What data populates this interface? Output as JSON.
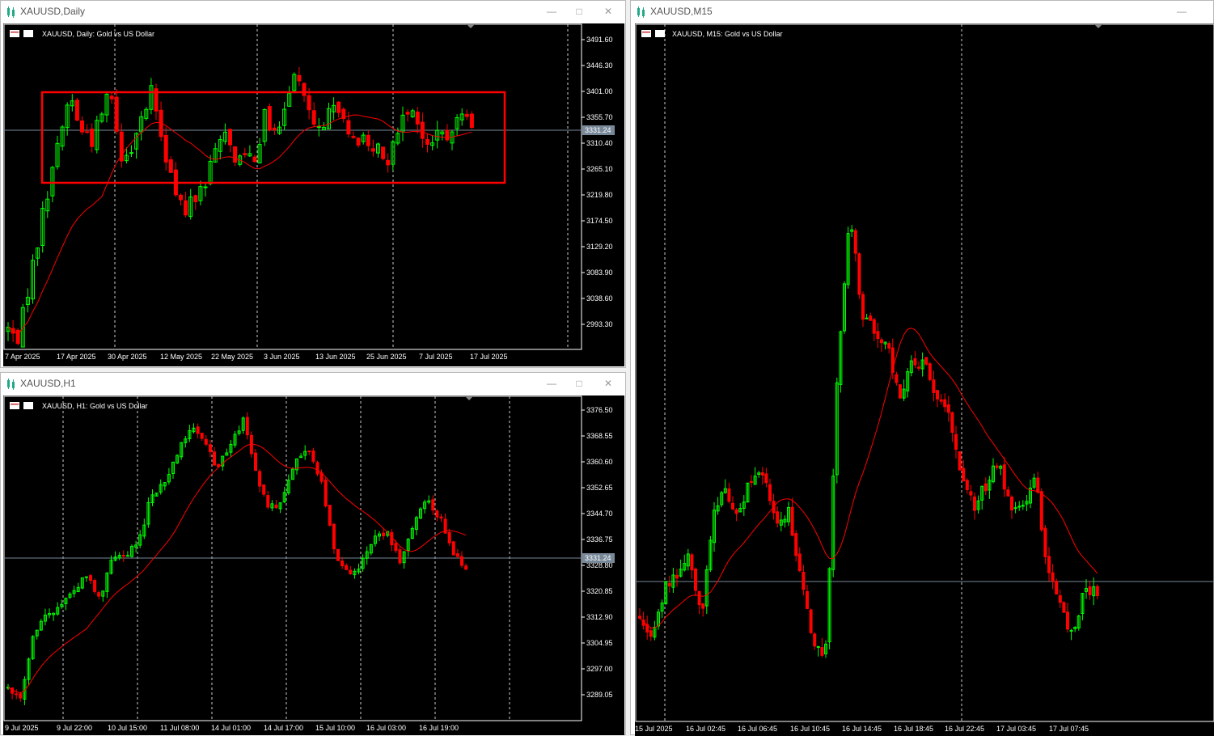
{
  "colors": {
    "bull": "#00ff00",
    "bear": "#ff0000",
    "ma": "#ff0000",
    "grid": "#ffffff",
    "priceLine": "#778899",
    "box": "#ff0000"
  },
  "windows": {
    "daily": {
      "title": "XAUUSD,Daily",
      "header": "XAUUSD, Daily:  Gold vs US Dollar",
      "price_tag": "3331.24",
      "icons": [
        "minimize-icon",
        "maximize-icon",
        "close-icon"
      ],
      "y_ticks": [
        "3491.60",
        "3446.30",
        "3401.00",
        "3355.70",
        "3310.40",
        "3265.10",
        "3219.80",
        "3174.50",
        "3129.20",
        "3083.90",
        "3038.60",
        "2993.30"
      ],
      "x_ticks": [
        "7 Apr 2025",
        "17 Apr 2025",
        "30 Apr 2025",
        "12 May 2025",
        "22 May 2025",
        "3 Jun 2025",
        "13 Jun 2025",
        "25 Jun 2025",
        "7 Jul 2025",
        "17 Jul 2025"
      ]
    },
    "h1": {
      "title": "XAUUSD,H1",
      "header": "XAUUSD, H1:  Gold vs US Dollar",
      "price_tag": "3331.24",
      "icons": [
        "minimize-icon",
        "maximize-icon",
        "close-icon"
      ],
      "y_ticks": [
        "3376.50",
        "3368.55",
        "3360.60",
        "3352.65",
        "3344.70",
        "3336.75",
        "3328.80",
        "3320.85",
        "3312.90",
        "3304.95",
        "3297.00",
        "3289.05"
      ],
      "x_ticks": [
        "9 Jul 2025",
        "9 Jul 22:00",
        "10 Jul 15:00",
        "11 Jul 08:00",
        "14 Jul 01:00",
        "14 Jul 17:00",
        "15 Jul 10:00",
        "16 Jul 03:00",
        "16 Jul 19:00"
      ]
    },
    "m15": {
      "title": "XAUUSD,M15",
      "header": "XAUUSD, M15:  Gold vs US Dollar",
      "icons": [
        "minimize-icon"
      ],
      "x_ticks": [
        "15 Jul 2025",
        "16 Jul 02:45",
        "16 Jul 06:45",
        "16 Jul 10:45",
        "16 Jul 14:45",
        "16 Jul 18:45",
        "16 Jul 22:45",
        "17 Jul 03:45",
        "17 Jul 07:45"
      ]
    }
  }
}
